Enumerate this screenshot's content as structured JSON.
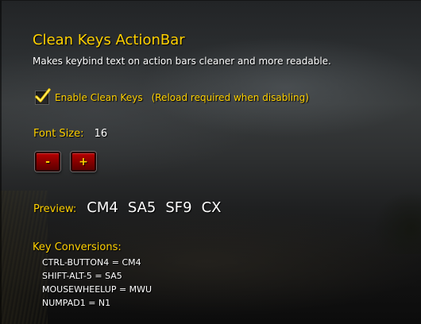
{
  "panel": {
    "title": "Clean Keys ActionBar",
    "description": "Makes keybind text on action bars cleaner and more readable."
  },
  "enable_option": {
    "label": "Enable Clean Keys",
    "note": "(Reload required when disabling)",
    "checked": true
  },
  "font_size": {
    "label": "Font Size:",
    "value": "16",
    "decrease_label": "-",
    "increase_label": "+"
  },
  "preview": {
    "label": "Preview:",
    "keys": [
      "CM4",
      "SA5",
      "SF9",
      "CX"
    ]
  },
  "conversions": {
    "title": "Key Conversions:",
    "items": [
      "CTRL-BUTTON4 = CM4",
      "SHIFT-ALT-5 = SA5",
      "MOUSEWHEELUP = MWU",
      "NUMPAD1 = N1"
    ]
  },
  "colors": {
    "label_gold": "#ffd100",
    "text_white": "#ffffff",
    "button_red": "#8c0000"
  }
}
